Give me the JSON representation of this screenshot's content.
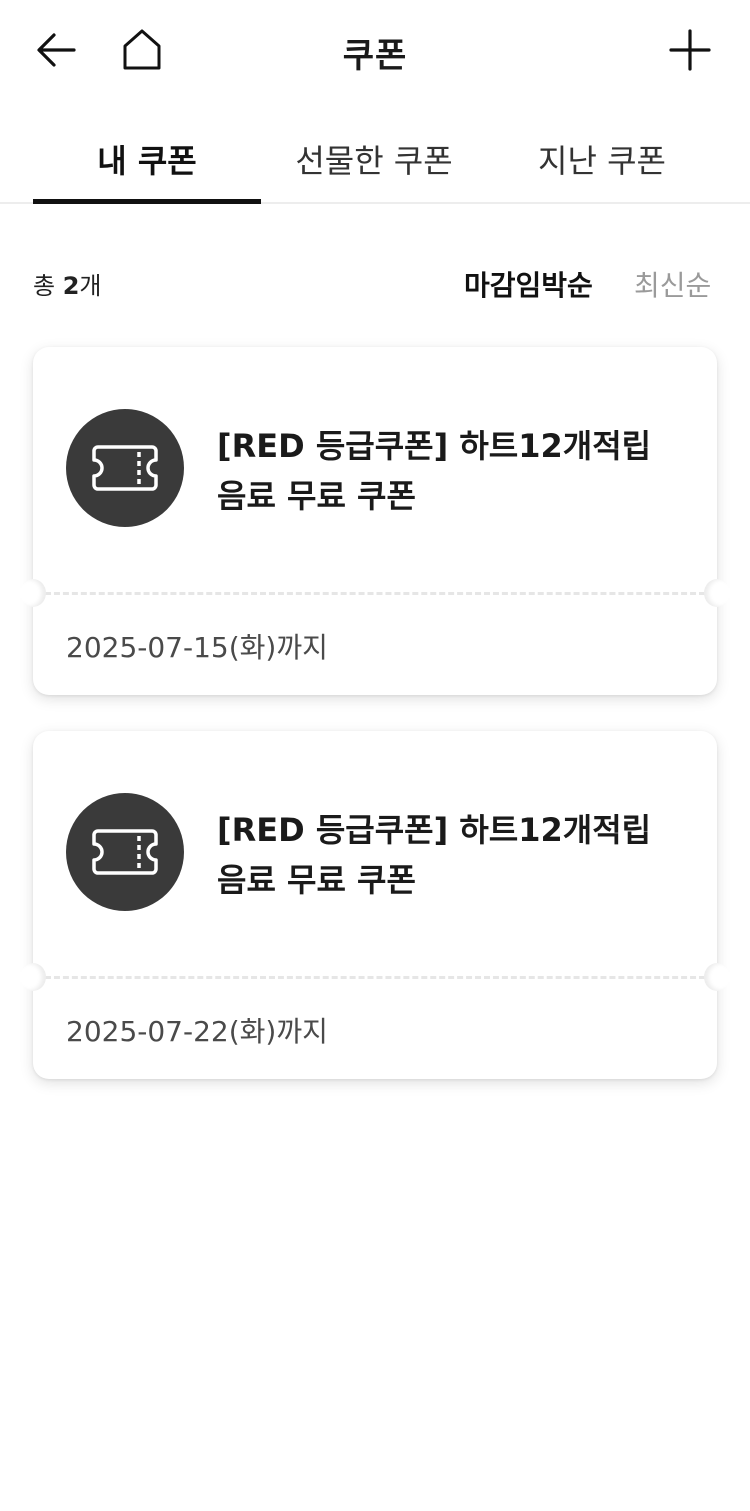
{
  "header": {
    "title": "쿠폰",
    "back_icon": "back-arrow-icon",
    "home_icon": "home-icon",
    "add_icon": "plus-icon"
  },
  "tabs": [
    {
      "label": "내 쿠폰",
      "active": true
    },
    {
      "label": "선물한 쿠폰",
      "active": false
    },
    {
      "label": "지난 쿠폰",
      "active": false
    }
  ],
  "summary": {
    "prefix": "총 ",
    "count": "2",
    "suffix": "개"
  },
  "sort": {
    "active": "마감임박순",
    "other": "최신순"
  },
  "coupons": [
    {
      "name": "[RED 등급쿠폰] 하트12개적립 음료 무료 쿠폰",
      "expiry": "2025-07-15(화)까지",
      "icon": "ticket-icon"
    },
    {
      "name": "[RED 등급쿠폰] 하트12개적립 음료 무료 쿠폰",
      "expiry": "2025-07-22(화)까지",
      "icon": "ticket-icon"
    }
  ],
  "colors": {
    "icon_bg": "#3a3a3a",
    "inactive_sort": "#9a9a9a",
    "active_tab": "#111111"
  }
}
